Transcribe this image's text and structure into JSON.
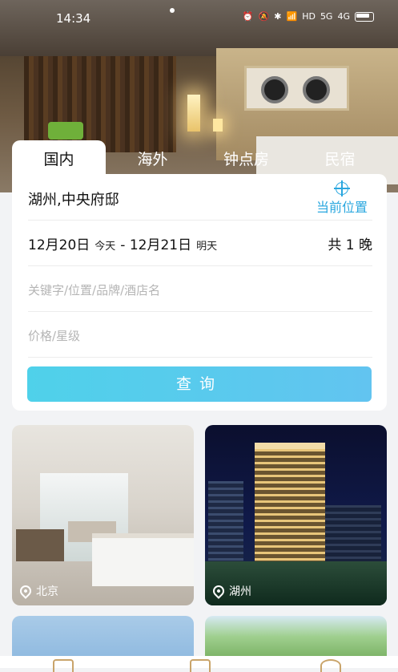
{
  "status_bar": {
    "time": "14:34",
    "signal_5g": "5G",
    "signal_4g": "4G",
    "hd": "HD"
  },
  "search": {
    "tabs": [
      "国内",
      "海外",
      "钟点房",
      "民宿"
    ],
    "active_tab": 0,
    "city": "湖州,中央府邸",
    "current_location_label": "当前位置",
    "checkin_date": "12月20日",
    "checkin_sub": "今天",
    "date_separator": "-",
    "checkout_date": "12月21日",
    "checkout_sub": "明天",
    "nights": "共 1 晚",
    "keyword_placeholder": "关键字/位置/品牌/酒店名",
    "price_placeholder": "价格/星级",
    "query_button": "查询"
  },
  "cards": [
    {
      "location": "北京",
      "icon": "location-pin-icon"
    },
    {
      "location": "湖州",
      "icon": "location-pin-icon"
    }
  ],
  "colors": {
    "accent": "#2aa7df",
    "button_gradient_start": "#4fd1ea",
    "button_gradient_end": "#62c4f0"
  }
}
